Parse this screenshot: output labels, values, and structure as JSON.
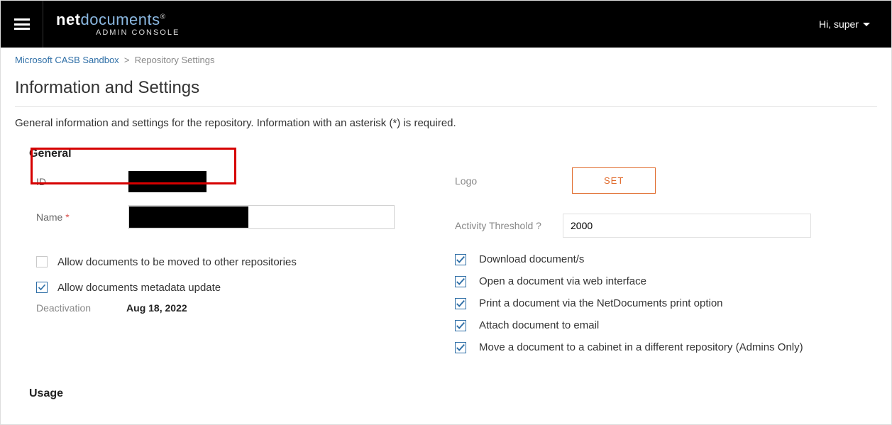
{
  "header": {
    "logo_bold": "net",
    "logo_light": "documents",
    "logo_reg": "®",
    "logo_sub": "ADMIN CONSOLE",
    "greeting": "Hi, super"
  },
  "breadcrumb": {
    "link": "Microsoft CASB Sandbox",
    "sep": ">",
    "current": "Repository Settings"
  },
  "page": {
    "title": "Information and Settings",
    "description": "General information and settings for the repository. Information with an asterisk (*) is required."
  },
  "general": {
    "heading": "General",
    "id_label": "ID",
    "name_label": "Name",
    "name_value": "",
    "allow_move": "Allow documents to be moved to other repositories",
    "allow_move_checked": false,
    "allow_metadata": "Allow documents metadata update",
    "allow_metadata_checked": true,
    "deactivation_label": "Deactivation",
    "deactivation_value": "Aug 18, 2022"
  },
  "right": {
    "logo_label": "Logo",
    "set_button": "SET",
    "activity_label": "Activity Threshold ?",
    "activity_value": "2000",
    "checks": [
      "Download document/s",
      "Open a document via web interface",
      "Print a document via the NetDocuments print option",
      "Attach document to email",
      "Move a document to a cabinet in a different repository (Admins Only)"
    ]
  },
  "usage": {
    "heading": "Usage"
  }
}
